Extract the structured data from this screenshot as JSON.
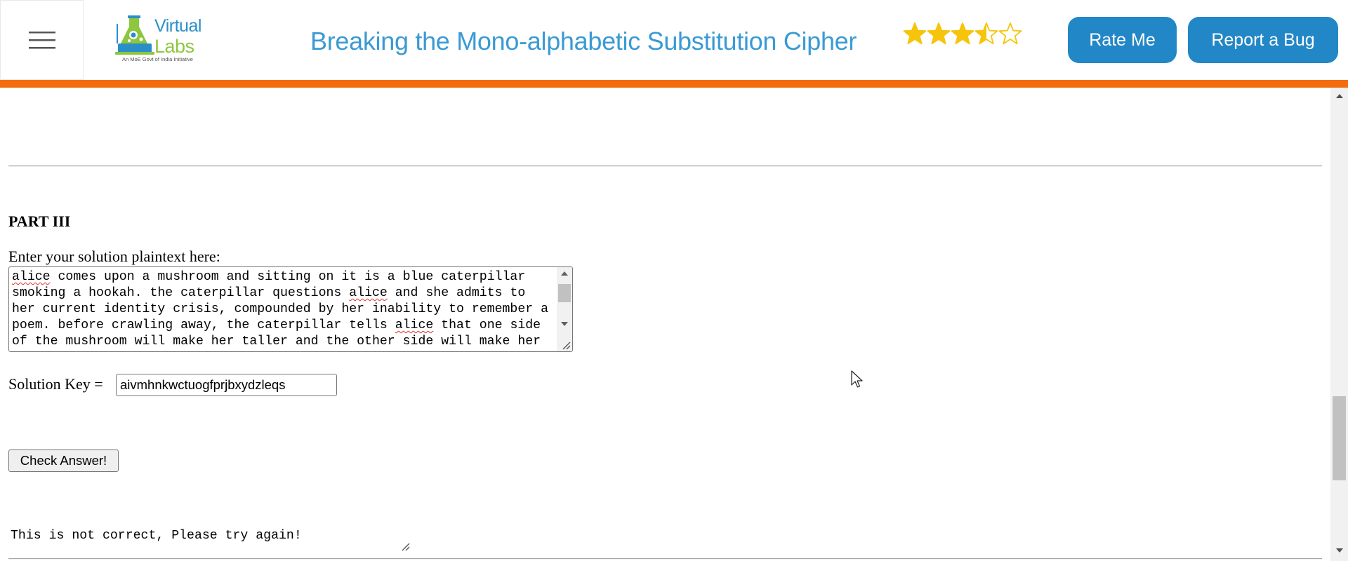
{
  "header": {
    "logo": {
      "line1": "Virtual",
      "line2": "Labs",
      "tagline": "An MoE Govt of India Initiative"
    },
    "title": "Breaking the Mono-alphabetic Substitution Cipher",
    "rating": 3.5,
    "rate_label": "Rate Me",
    "bug_label": "Report a Bug",
    "accent_color": "#f36c0e",
    "button_color": "#2287c6",
    "star_color": "#f6c40b"
  },
  "part3": {
    "heading": "PART III",
    "prompt": "Enter your solution plaintext here:",
    "solution_lines": [
      [
        {
          "t": "alice",
          "s": true
        },
        {
          "t": " comes upon a mushroom and sitting on it is a blue caterpillar"
        }
      ],
      [
        {
          "t": "smoking a hookah. the caterpillar questions "
        },
        {
          "t": "alice",
          "s": true
        },
        {
          "t": " and she admits to"
        }
      ],
      [
        {
          "t": "her current identity crisis, compounded by her inability to remember a"
        }
      ],
      [
        {
          "t": "poem. before crawling away, the caterpillar tells "
        },
        {
          "t": "alice",
          "s": true
        },
        {
          "t": " that one side"
        }
      ],
      [
        {
          "t": "of the mushroom will make her taller and the other side will make her"
        }
      ]
    ],
    "key_label": "Solution Key =",
    "key_value": "aivmhnkwctuogfprjbxydzleqs",
    "check_label": "Check Answer!",
    "result": "This is not correct, Please try again!"
  }
}
